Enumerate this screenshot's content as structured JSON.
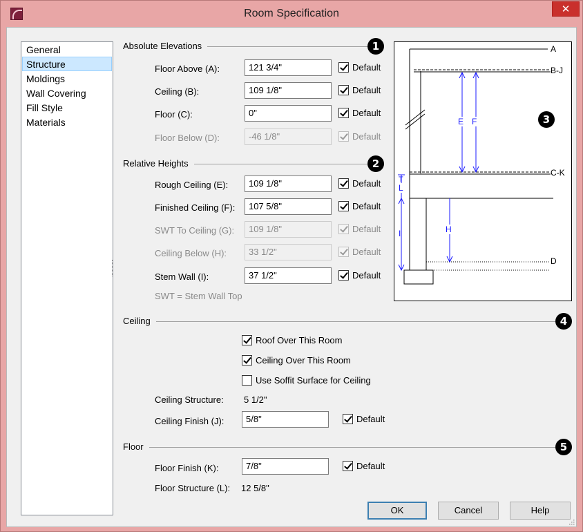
{
  "window": {
    "title": "Room Specification",
    "close_glyph": "✕"
  },
  "nav": {
    "items": [
      "General",
      "Structure",
      "Moldings",
      "Wall Covering",
      "Fill Style",
      "Materials"
    ],
    "selected": 1
  },
  "absolute": {
    "title": "Absolute Elevations",
    "badge": "1",
    "rows": [
      {
        "label": "Floor Above (A):",
        "value": "121 3/4\"",
        "default": "Default",
        "checked": true,
        "enabled": true
      },
      {
        "label": "Ceiling (B):",
        "value": "109 1/8\"",
        "default": "Default",
        "checked": true,
        "enabled": true
      },
      {
        "label": "Floor (C):",
        "value": "0\"",
        "default": "Default",
        "checked": true,
        "enabled": true
      },
      {
        "label": "Floor Below (D):",
        "value": "-46 1/8\"",
        "default": "Default",
        "checked": true,
        "enabled": false
      }
    ]
  },
  "relative": {
    "title": "Relative Heights",
    "badge": "2",
    "rows": [
      {
        "label": "Rough Ceiling (E):",
        "value": "109 1/8\"",
        "default": "Default",
        "checked": true,
        "enabled": true
      },
      {
        "label": "Finished Ceiling (F):",
        "value": "107 5/8\"",
        "default": "Default",
        "checked": true,
        "enabled": true
      },
      {
        "label": "SWT To Ceiling (G):",
        "value": "109 1/8\"",
        "default": "Default",
        "checked": true,
        "enabled": false
      },
      {
        "label": "Ceiling Below (H):",
        "value": "33 1/2\"",
        "default": "Default",
        "checked": true,
        "enabled": false
      },
      {
        "label": "Stem Wall (I):",
        "value": "37 1/2\"",
        "default": "Default",
        "checked": true,
        "enabled": true
      }
    ],
    "note": "SWT = Stem Wall Top"
  },
  "diagram": {
    "badge": "3",
    "labels": {
      "A": "A",
      "BJ": "B-J",
      "CK": "C-K",
      "D": "D",
      "E": "E",
      "F": "F",
      "H": "H",
      "I": "I",
      "T": "T",
      "L": "L"
    }
  },
  "ceiling": {
    "title": "Ceiling",
    "badge": "4",
    "roof_over": {
      "label": "Roof Over This Room",
      "checked": true
    },
    "ceiling_over": {
      "label": "Ceiling Over This Room",
      "checked": true
    },
    "soffit": {
      "label": "Use Soffit Surface for Ceiling",
      "checked": false
    },
    "structure_label": "Ceiling Structure:",
    "structure_value": "5 1/2\"",
    "finish_label": "Ceiling Finish (J):",
    "finish_value": "5/8\"",
    "finish_default": "Default",
    "finish_default_checked": true
  },
  "floor": {
    "title": "Floor",
    "badge": "5",
    "finish_label": "Floor Finish (K):",
    "finish_value": "7/8\"",
    "finish_default": "Default",
    "finish_default_checked": true,
    "structure_label": "Floor Structure (L):",
    "structure_value": "12 5/8\""
  },
  "buttons": {
    "ok": "OK",
    "cancel": "Cancel",
    "help": "Help"
  },
  "colors": {
    "titlebar": "#e8a6a6",
    "close": "#c9302c",
    "selection": "#cce8ff",
    "diagram_dim": "#1a1aff"
  }
}
